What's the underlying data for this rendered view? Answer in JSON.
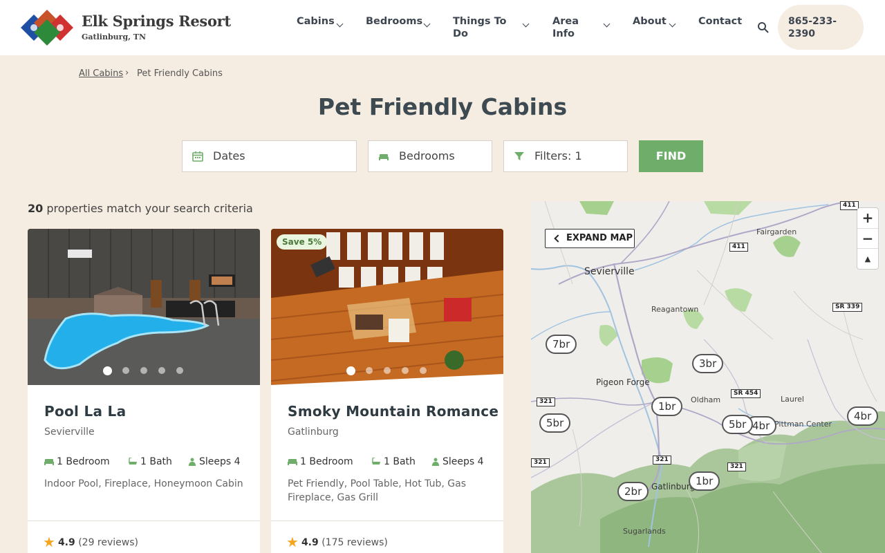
{
  "header": {
    "brand_name": "Elk Springs Resort",
    "brand_location": "Gatlinburg, TN",
    "nav": [
      {
        "label": "Cabins"
      },
      {
        "label": "Bedrooms"
      },
      {
        "label": "Things To Do"
      },
      {
        "label": "Area Info"
      },
      {
        "label": "About"
      },
      {
        "label": "Contact"
      }
    ],
    "phone": "865-233-2390"
  },
  "breadcrumb": {
    "link": "All Cabins",
    "separator": "›",
    "current": "Pet Friendly Cabins"
  },
  "page_title": "Pet Friendly Cabins",
  "search": {
    "dates": "Dates",
    "bedrooms": "Bedrooms",
    "filters": "Filters: 1",
    "find": "FIND"
  },
  "results": {
    "count": "20",
    "text": " properties match your search criteria"
  },
  "cards": [
    {
      "title": "Pool La La",
      "location": "Sevierville",
      "bedrooms": "1 Bedroom",
      "baths": "1 Bath",
      "sleeps": "Sleeps 4",
      "amenities": "Indoor Pool, Fireplace, Honeymoon Cabin",
      "rating": "4.9",
      "reviews": "(29 reviews)",
      "badge": ""
    },
    {
      "title": "Smoky Mountain Romance",
      "location": "Gatlinburg",
      "bedrooms": "1 Bedroom",
      "baths": "1 Bath",
      "sleeps": "Sleeps 4",
      "amenities": "Pet Friendly, Pool Table, Hot Tub, Gas Fireplace, Gas Grill",
      "rating": "4.9",
      "reviews": "(175 reviews)",
      "badge": "Save 5%"
    }
  ],
  "map": {
    "expand_label": "EXPAND MAP",
    "zoom_in": "+",
    "zoom_out": "−",
    "compass": "▲",
    "places": [
      "Sevierville",
      "Fairgarden",
      "Reagantown",
      "Pigeon Forge",
      "Oldham",
      "Laurel",
      "Pittman Center",
      "Gatlinburg",
      "Sugarlands"
    ],
    "shields": [
      "411",
      "411",
      "SR 339",
      "SR 454",
      "321",
      "321",
      "321",
      "321"
    ],
    "pins": [
      "7br",
      "3br",
      "1br",
      "5br",
      "5br",
      "4br",
      "4br",
      "2br",
      "1br"
    ]
  },
  "colors": {
    "accent_green": "#6fae6a",
    "page_bg": "#f5ece2",
    "star": "#f4a623"
  }
}
